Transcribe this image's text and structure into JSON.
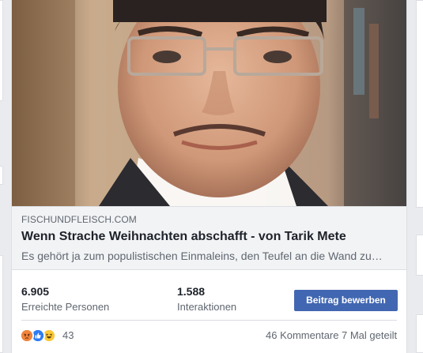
{
  "link": {
    "domain": "FISCHUNDFLEISCH.COM",
    "headline": "Wenn Strache Weihnachten abschafft - von Tarik Mete",
    "description": "Es gehört ja zum populistischen Einmaleins, den Teufel an die Wand zu…"
  },
  "insights": {
    "reach_value": "6.905",
    "reach_label": "Erreichte Personen",
    "engagement_value": "1.588",
    "engagement_label": "Interaktionen",
    "boost_label": "Beitrag bewerben"
  },
  "social": {
    "reaction_icons": [
      "angry-icon",
      "like-icon",
      "haha-icon"
    ],
    "reaction_count": "43",
    "comments": "46 Kommentare",
    "shares": "7 Mal geteilt"
  },
  "colors": {
    "accent": "#4267b2",
    "text_primary": "#1d2129",
    "text_secondary": "#606770",
    "link_box_bg": "#f2f3f5",
    "page_bg": "#e9ebee"
  }
}
